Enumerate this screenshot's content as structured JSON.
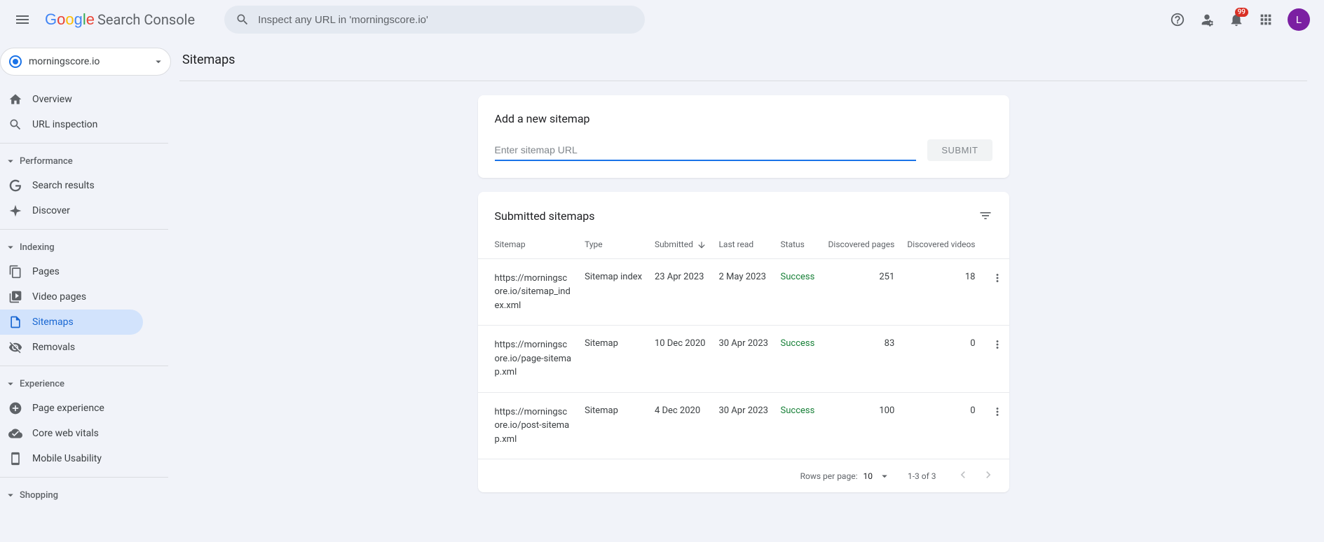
{
  "header": {
    "logo_text": "Search Console",
    "search_placeholder": "Inspect any URL in 'morningscore.io'",
    "notif_count": "99",
    "avatar_letter": "L"
  },
  "property": {
    "name": "morningscore.io"
  },
  "sidebar": {
    "overview": "Overview",
    "url_inspection": "URL inspection",
    "performance_header": "Performance",
    "search_results": "Search results",
    "discover": "Discover",
    "indexing_header": "Indexing",
    "pages": "Pages",
    "video_pages": "Video pages",
    "sitemaps": "Sitemaps",
    "removals": "Removals",
    "experience_header": "Experience",
    "page_experience": "Page experience",
    "core_web_vitals": "Core web vitals",
    "mobile_usability": "Mobile Usability",
    "shopping_header": "Shopping"
  },
  "page": {
    "title": "Sitemaps"
  },
  "add_sitemap": {
    "title": "Add a new sitemap",
    "placeholder": "Enter sitemap URL",
    "submit": "SUBMIT"
  },
  "submitted": {
    "title": "Submitted sitemaps",
    "columns": {
      "sitemap": "Sitemap",
      "type": "Type",
      "submitted": "Submitted",
      "last_read": "Last read",
      "status": "Status",
      "pages": "Discovered pages",
      "videos": "Discovered videos"
    },
    "rows": [
      {
        "url": "https://morningscore.io/sitemap_index.xml",
        "type": "Sitemap index",
        "submitted": "23 Apr 2023",
        "last_read": "2 May 2023",
        "status": "Success",
        "pages": "251",
        "videos": "18"
      },
      {
        "url": "https://morningscore.io/page-sitemap.xml",
        "type": "Sitemap",
        "submitted": "10 Dec 2020",
        "last_read": "30 Apr 2023",
        "status": "Success",
        "pages": "83",
        "videos": "0"
      },
      {
        "url": "https://morningscore.io/post-sitemap.xml",
        "type": "Sitemap",
        "submitted": "4 Dec 2020",
        "last_read": "30 Apr 2023",
        "status": "Success",
        "pages": "100",
        "videos": "0"
      }
    ],
    "footer": {
      "rows_per_page": "Rows per page:",
      "page_size": "10",
      "range": "1-3 of 3"
    }
  }
}
